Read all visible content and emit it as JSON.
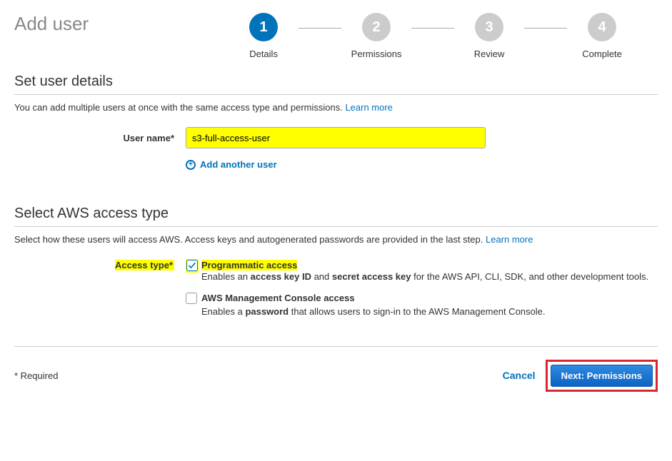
{
  "header": {
    "title": "Add user",
    "steps": [
      {
        "num": "1",
        "label": "Details",
        "active": true
      },
      {
        "num": "2",
        "label": "Permissions",
        "active": false
      },
      {
        "num": "3",
        "label": "Review",
        "active": false
      },
      {
        "num": "4",
        "label": "Complete",
        "active": false
      }
    ]
  },
  "details": {
    "section_title": "Set user details",
    "subtitle_prefix": "You can add multiple users at once with the same access type and permissions. ",
    "learn_more": "Learn more",
    "username_label": "User name",
    "username_value": "s3-full-access-user",
    "add_another": "Add another user"
  },
  "access": {
    "section_title": "Select AWS access type",
    "subtitle_prefix": "Select how these users will access AWS. Access keys and autogenerated passwords are provided in the last step. ",
    "learn_more": "Learn more",
    "access_type_label": "Access type",
    "options": [
      {
        "title": "Programmatic access",
        "checked": true,
        "desc_pre": "Enables an ",
        "desc_b1": "access key ID",
        "desc_mid": " and ",
        "desc_b2": "secret access key",
        "desc_post": " for the AWS API, CLI, SDK, and other development tools."
      },
      {
        "title": "AWS Management Console access",
        "checked": false,
        "desc_pre": "Enables a ",
        "desc_b1": "password",
        "desc_mid": "",
        "desc_b2": "",
        "desc_post": " that allows users to sign-in to the AWS Management Console."
      }
    ]
  },
  "footer": {
    "required_note": "* Required",
    "cancel": "Cancel",
    "next": "Next: Permissions"
  },
  "glyphs": {
    "required_star": "*",
    "plus": "+"
  }
}
